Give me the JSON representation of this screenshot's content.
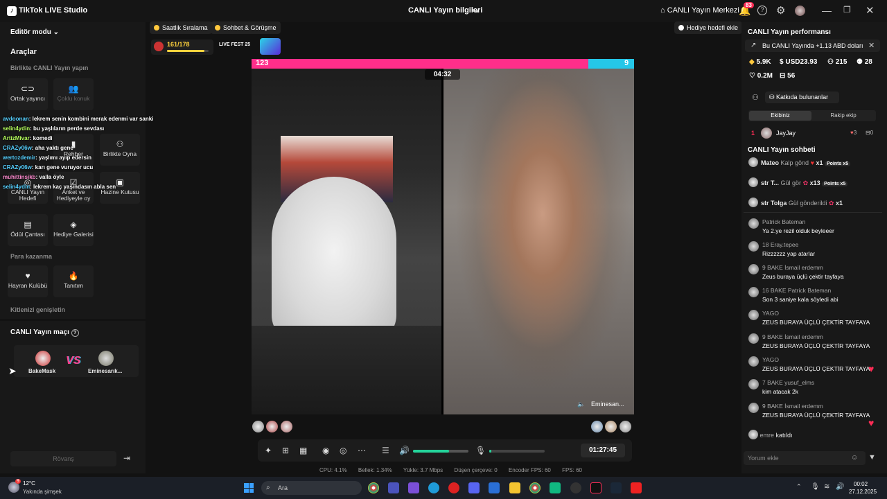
{
  "titlebar": {
    "app_name": "TikTok LIVE Studio",
    "stream_info": "CANLI Yayın bilgileri",
    "live_center": "CANLI Yayın Merkezi",
    "notification_count": "83"
  },
  "left_panel": {
    "editor_mode": "Editör modu",
    "tools_title": "Araçlar",
    "section_together": "Birlikte CANLI Yayın yapın",
    "tool_cohost": "Ortak yayıncı",
    "tool_multiguest": "Çoklu konuk",
    "tool_guide": "Rehber",
    "tool_play_together": "Birlikte Oyna",
    "tool_live_goal": "CANLI Yayın Hedefi",
    "tool_survey": "Anket ve Hediyeyle oy",
    "tool_treasure": "Hazine Kutusu",
    "tool_reward_bag": "Ödül Çantası",
    "tool_gift_gallery": "Hediye Galerisi",
    "section_monetize": "Para kazanma",
    "tool_fan_club": "Hayran Kulübü",
    "tool_promo": "Tanıtım",
    "section_expand": "Kitlenizi genişletin",
    "match_title": "CANLI Yayın maçı",
    "player1": "BakeMask",
    "vs": "VS",
    "player2": "Eminesarık...",
    "rematch": "Rövanş"
  },
  "chat_overlay": [
    {
      "user": "avdoonan",
      "msg": ": lekrem senin kombini merak edenmi var sanki"
    },
    {
      "user": "selin4ydin",
      "msg": ": bu yaşlıların perde sevdası"
    },
    {
      "user": "ArtizMivar",
      "msg": ": komedi"
    },
    {
      "user": "CRAZy06w",
      "msg": ": aha yaktı gene"
    },
    {
      "user": "wertozdemir",
      "msg": ": yaşlımı ayıp edersin"
    },
    {
      "user": "CRAZy06w",
      "msg": ": karı gene vuruyor ucu"
    },
    {
      "user": "muhittinsikb",
      "msg": ": valla öyle"
    },
    {
      "user": "selin4ydin",
      "msg": ": lekrem kaç yaşındasın abla sen"
    }
  ],
  "top_strip": {
    "hourly_ranking": "Saatlik Sıralama",
    "chat_meet": "Sohbet & Görüşme",
    "progress_text": "161/178",
    "event_name": "LIVE FEST 25",
    "add_gift_goal": "Hediye hedefi ekle"
  },
  "battle": {
    "score_left": "123",
    "score_right": "9",
    "timer": "04:32",
    "opponent_label": "Eminesan..."
  },
  "controls": {
    "volume_level": 0.65,
    "elapsed": "01:27:45"
  },
  "stats": {
    "cpu": "CPU: 4.1%",
    "memory": "Bellek: 1.34%",
    "upload": "Yükle: 3.7 Mbps",
    "dropped": "Düşen çerçeve: 0",
    "encoder_fps": "Encoder FPS: 60",
    "fps": "FPS: 60"
  },
  "right_panel": {
    "perf_title": "CANLI Yayın performansı",
    "earnings_note": "Bu CANLI Yayında +1.13 ABD doları",
    "kpi_diamonds": "5.9K",
    "kpi_usd": "USD23.93",
    "kpi_viewers": "215",
    "kpi_new": "28",
    "kpi_likes": "0.2M",
    "kpi_gifts": "56",
    "contributors": "Katkıda bulunanlar",
    "tab_ours": "Ekibiniz",
    "tab_rival": "Rakip ekip",
    "top_rank": "1",
    "top_user": "JayJay",
    "top_likes": "3",
    "top_gifts": "0",
    "chat_title": "CANLI Yayın sohbeti",
    "gift_rows": [
      {
        "user": "Mateo",
        "action": "Kalp gönd",
        "count": "x1",
        "points": "Points x5"
      },
      {
        "user": "str T...",
        "action": "Gül gör",
        "count": "x13",
        "points": "Points x5"
      },
      {
        "user": "str Tolga",
        "action": "Gül gönderildi",
        "count": "x1",
        "points": ""
      }
    ],
    "comments": [
      {
        "meta": "Patrick Bateman",
        "text": "Ya 2.ye rezil olduk beyleeer"
      },
      {
        "meta": "18  Eray.tepee",
        "text": "Rizzzzzz yap atarlar"
      },
      {
        "meta": "9  BAKE  İsmail erdemm",
        "text": "Zeus buraya üçlü çektir tayfaya"
      },
      {
        "meta": "16  BAKE  Patrick Bateman",
        "text": "Son 3 saniye kala söyledi abi"
      },
      {
        "meta": "YAGO",
        "text": "ZEUS BURAYA ÜÇLÜ ÇEKTİR TAYFAYA"
      },
      {
        "meta": "9  BAKE  İsmail erdemm",
        "text": "ZEUS BURAYA ÜÇLÜ ÇEKTİR TAYFAYA"
      },
      {
        "meta": "YAGO",
        "text": "ZEUS BURAYA ÜÇLÜ ÇEKTİR TAYFAYA"
      },
      {
        "meta": "7  BAKE  yusuf_elms",
        "text": "kim atacak 2k"
      },
      {
        "meta": "9  BAKE  İsmail erdemm",
        "text": "ZEUS BURAYA ÜÇLÜ ÇEKTİR TAYFAYA"
      }
    ],
    "joined_user": "emre",
    "joined_text": "katıldı",
    "comment_placeholder": "Yorum ekle"
  },
  "taskbar": {
    "weather_temp": "12°C",
    "weather_desc": "Yakında şimşek",
    "weather_badge": "9",
    "search_placeholder": "Ara",
    "time": "00:02",
    "date": "27.12.2025"
  },
  "colors": {
    "accent_pink": "#fe2c55",
    "accent_cyan": "#25c7e8",
    "volume_green": "#24d39a"
  }
}
